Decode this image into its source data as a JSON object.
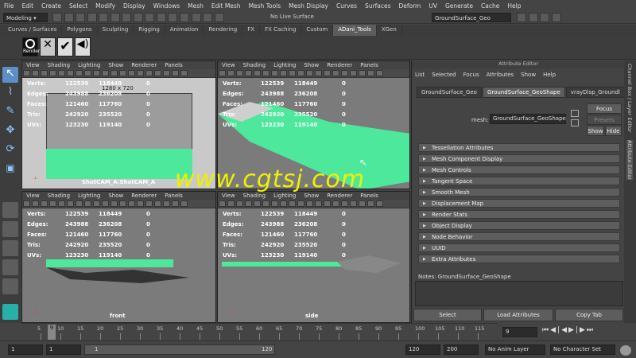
{
  "menubar": [
    "File",
    "Edit",
    "Create",
    "Select",
    "Modify",
    "Display",
    "Windows",
    "Mesh",
    "Edit Mesh",
    "Mesh Tools",
    "Mesh Display",
    "Curves",
    "Surfaces",
    "Deform",
    "UV",
    "Generate",
    "Cache",
    "Help"
  ],
  "statusline": {
    "mode": "Modeling",
    "live_surface": "No Live Surface",
    "object_field": "GroundSurface_Geo"
  },
  "shelf_tabs": [
    "Curves / Surfaces",
    "Polygons",
    "Sculpting",
    "Rigging",
    "Animation",
    "Rendering",
    "FX",
    "FX Caching",
    "Custom",
    "ADani_Tools",
    "XGen"
  ],
  "shelf_active": "ADani_Tools",
  "shelf_render_label": "Render",
  "vp_menu": [
    "View",
    "Shading",
    "Lighting",
    "Show",
    "Renderer",
    "Panels"
  ],
  "hud": {
    "labels": [
      "Verts:",
      "Edges:",
      "Faces:",
      "Tris:",
      "UVs:"
    ],
    "col1": [
      "122539",
      "243988",
      "121460",
      "242920",
      "123230"
    ],
    "col2": [
      "118449",
      "236208",
      "117760",
      "235520",
      "119140"
    ],
    "col3": [
      "0",
      "0",
      "0",
      "0",
      "0"
    ]
  },
  "viewports": {
    "persp_resolution": "1280 x 720",
    "persp_camera": "ShotCAM_A:ShotCAM_A",
    "front_label": "front",
    "side_label": "side"
  },
  "attribute_editor": {
    "title": "Attribute Editor",
    "menu": [
      "List",
      "Selected",
      "Focus",
      "Attributes",
      "Show",
      "Help"
    ],
    "tabs": [
      "GroundSurface_Geo",
      "GroundSurface_GeoShape",
      "vrayDisp_Groundl"
    ],
    "active_tab": "GroundSurface_GeoShape",
    "mesh_label": "mesh:",
    "mesh_value": "GroundSurface_GeoShape",
    "focus": "Focus",
    "presets": "Presets",
    "show": "Show",
    "hide": "Hide",
    "sections": [
      "Tessellation Attributes",
      "Mesh Component Display",
      "Mesh Controls",
      "Tangent Space",
      "Smooth Mesh",
      "Displacement Map",
      "Render Stats",
      "Object Display",
      "Node Behavior",
      "UUID",
      "Extra Attributes"
    ],
    "notes_label": "Notes:  GroundSurface_GeoShape",
    "bottom_buttons": [
      "Select",
      "Load Attributes",
      "Copy Tab"
    ]
  },
  "right_strip": [
    "Channel Box / Layer Editor",
    "Attribute Editor"
  ],
  "timeline": {
    "ticks": [
      "5",
      "10",
      "15",
      "20",
      "25",
      "30",
      "35",
      "40",
      "45",
      "50",
      "55",
      "60",
      "65",
      "70",
      "75",
      "80",
      "85",
      "90",
      "95",
      "100",
      "105",
      "110",
      "115"
    ],
    "current_frame_left": "9",
    "current_frame_field": "9"
  },
  "range": {
    "start": "1",
    "start2": "1",
    "range_start": "1",
    "range_end": "120",
    "end": "120",
    "end2": "200",
    "anim_layer": "No Anim Layer",
    "char_set": "No Character Set"
  },
  "watermark": "www.cgtsj.com",
  "colors": {
    "mesh_green": "#4de89c",
    "accent": "#5d8ec7",
    "watermark": "#f0f000"
  }
}
